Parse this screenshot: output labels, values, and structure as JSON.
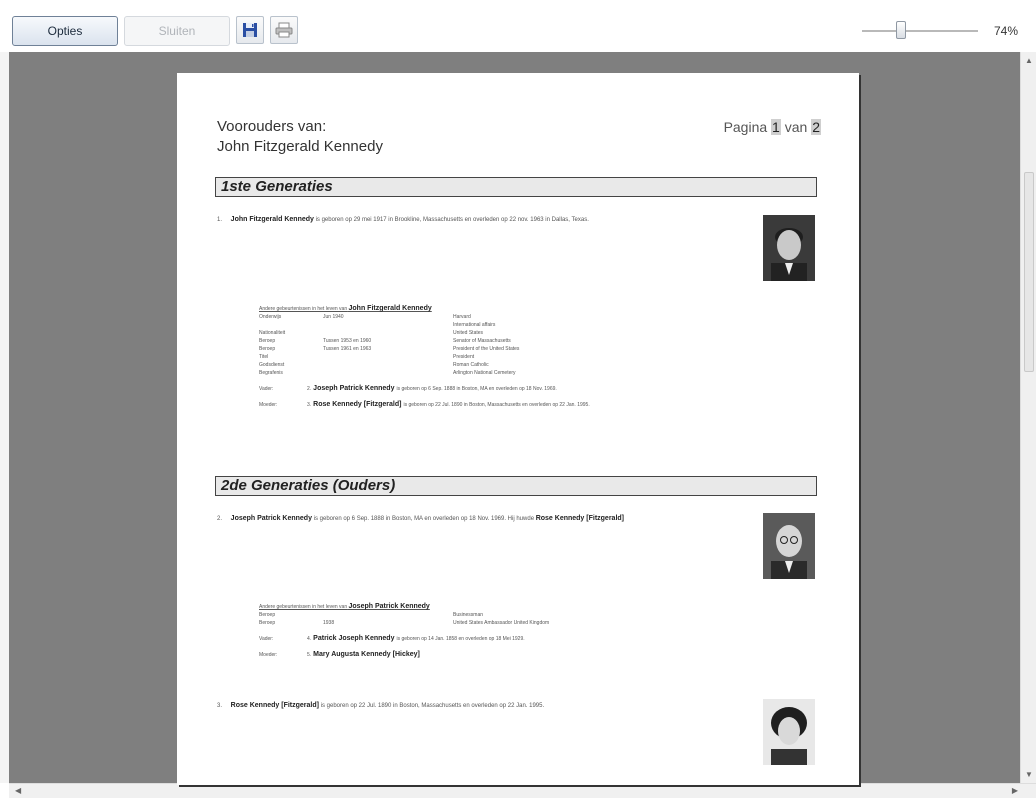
{
  "toolbar": {
    "opties_label": "Opties",
    "sluiten_label": "Sluiten",
    "zoom": "74%"
  },
  "page": {
    "title_line1": "Voorouders van:",
    "title_line2": "John Fitzgerald Kennedy",
    "pagina_prefix": "Pagina",
    "pagina_current": "1",
    "pagina_mid": "van",
    "pagina_total": "2"
  },
  "gen1": {
    "heading": "1ste Generaties",
    "num": "1.",
    "name": "John Fitzgerald Kennedy",
    "desc": "is geboren op 29 mei 1917 in Brookline, Massachusetts en overleden op 22 nov. 1963 in Dallas, Texas.",
    "details_head": "Andere gebeurtenissen in het leven van",
    "details_name": "John Fitzgerald Kennedy",
    "rows": [
      {
        "k": "Onderwijs",
        "v": "Jun 1940",
        "w": "Harvard"
      },
      {
        "k": "",
        "v": "",
        "w": "International affairs"
      },
      {
        "k": "Nationaliteit",
        "v": "",
        "w": "United States"
      },
      {
        "k": "Beroep",
        "v": "Tussen 1953 en 1960",
        "w": "Senator of Massachusetts"
      },
      {
        "k": "Beroep",
        "v": "Tussen 1961 en 1963",
        "w": "President of the United States"
      },
      {
        "k": "Titel",
        "v": "",
        "w": "President"
      },
      {
        "k": "Godsdienst",
        "v": "",
        "w": "Roman Catholic"
      },
      {
        "k": "Begrafenis",
        "v": "",
        "w": "Arlington National Cemetery"
      }
    ],
    "father_role": "Vader:",
    "father_num": "2.",
    "father_name": "Joseph Patrick Kennedy",
    "father_desc": "is geboren op 6 Sep. 1888 in Boston, MA en overleden op 18 Nov. 1969.",
    "mother_role": "Moeder:",
    "mother_num": "3.",
    "mother_name": "Rose Kennedy [Fitzgerald]",
    "mother_desc": "is geboren op 22 Jul. 1890 in Boston, Massachusetts en overleden op 22 Jan. 1995."
  },
  "gen2": {
    "heading": "2de Generaties (Ouders)",
    "e1_num": "2.",
    "e1_name": "Joseph Patrick Kennedy",
    "e1_desc": "is geboren op 6 Sep. 1888 in Boston, MA en overleden op 18 Nov. 1969. Hij huwde",
    "e1_spouse": "Rose Kennedy [Fitzgerald]",
    "details_head": "Andere gebeurtenissen in het leven van",
    "details_name": "Joseph Patrick Kennedy",
    "rows": [
      {
        "k": "Beroep",
        "v": "",
        "w": "Businessman"
      },
      {
        "k": "Beroep",
        "v": "1938",
        "w": "United States Ambassador United Kingdom"
      }
    ],
    "father_role": "Vader:",
    "father_num": "4.",
    "father_name": "Patrick Joseph Kennedy",
    "father_desc": "is geboren op 14 Jan. 1858 en overleden op 18 Mei 1929.",
    "mother_role": "Moeder:",
    "mother_num": "5.",
    "mother_name": "Mary Augusta Kennedy [Hickey]",
    "e2_num": "3.",
    "e2_name": "Rose Kennedy [Fitzgerald]",
    "e2_desc": "is geboren op 22 Jul. 1890 in Boston, Massachusetts en overleden op 22 Jan. 1995."
  }
}
